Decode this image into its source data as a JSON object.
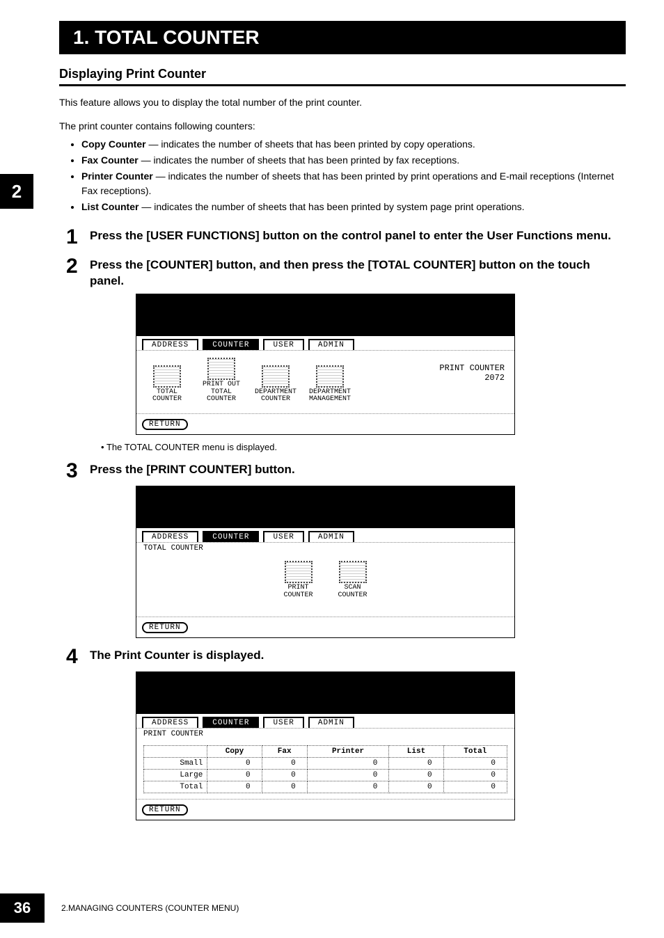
{
  "side_tab": "2",
  "title": "1. TOTAL COUNTER",
  "section_title": "Displaying Print Counter",
  "intro": "This feature allows you to display the total number of the print counter.",
  "lead": "The print counter contains following counters:",
  "counters": [
    {
      "name": "Copy Counter",
      "desc": " — indicates the number of sheets that has been printed by copy operations."
    },
    {
      "name": "Fax Counter",
      "desc": " — indicates the number of sheets that has been printed by fax receptions."
    },
    {
      "name": "Printer Counter",
      "desc": " — indicates the number of sheets that has been printed by print operations and E-mail receptions (Internet Fax receptions)."
    },
    {
      "name": "List Counter",
      "desc": " — indicates the number of sheets that has been printed by system page print operations."
    }
  ],
  "steps": {
    "s1": "Press the [USER FUNCTIONS] button on the control panel to enter the User Functions menu.",
    "s2": "Press the [COUNTER] button, and then press the [TOTAL COUNTER] button on the touch panel.",
    "s2_note": "The TOTAL COUNTER menu is displayed.",
    "s3": "Press the [PRINT COUNTER] button.",
    "s4": "The Print Counter is displayed."
  },
  "tabs": {
    "address": "ADDRESS",
    "counter": "COUNTER",
    "user": "USER",
    "admin": "ADMIN"
  },
  "screen1": {
    "icons": [
      "TOTAL COUNTER",
      "PRINT OUT TOTAL COUNTER",
      "DEPARTMENT COUNTER",
      "DEPARTMENT MANAGEMENT"
    ],
    "right_label": "PRINT COUNTER",
    "right_value": "2072",
    "return": "RETURN"
  },
  "screen2": {
    "caption": "TOTAL COUNTER",
    "icons": [
      "PRINT COUNTER",
      "SCAN COUNTER"
    ],
    "return": "RETURN"
  },
  "screen3": {
    "caption": "PRINT COUNTER",
    "headers": [
      "",
      "Copy",
      "Fax",
      "Printer",
      "List",
      "Total"
    ],
    "rows": [
      {
        "label": "Small",
        "vals": [
          "0",
          "0",
          "0",
          "0",
          "0"
        ]
      },
      {
        "label": "Large",
        "vals": [
          "0",
          "0",
          "0",
          "0",
          "0"
        ]
      },
      {
        "label": "Total",
        "vals": [
          "0",
          "0",
          "0",
          "0",
          "0"
        ]
      }
    ],
    "return": "RETURN"
  },
  "footer": {
    "page": "36",
    "text": "2.MANAGING COUNTERS (COUNTER MENU)"
  }
}
